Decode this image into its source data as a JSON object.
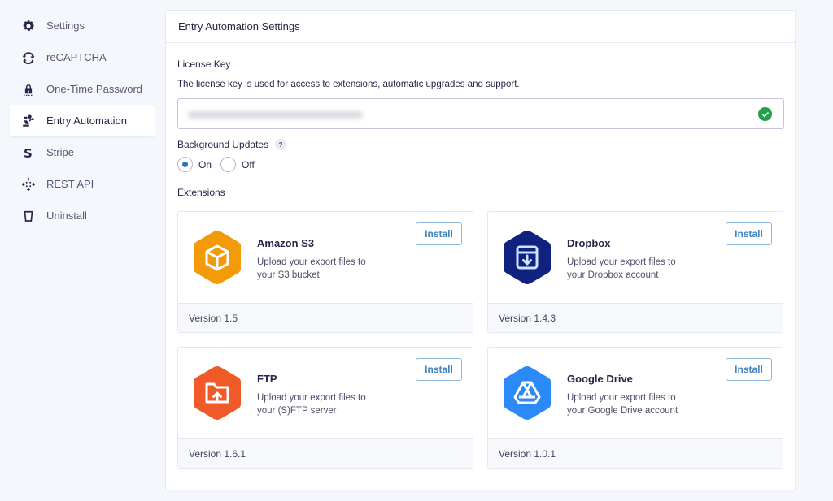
{
  "sidebar": {
    "items": [
      {
        "label": "Settings",
        "icon": "gear-icon",
        "active": false
      },
      {
        "label": "reCAPTCHA",
        "icon": "recaptcha-icon",
        "active": false
      },
      {
        "label": "One-Time Password",
        "icon": "lock-icon",
        "active": false
      },
      {
        "label": "Entry Automation",
        "icon": "robot-arm-icon",
        "active": true
      },
      {
        "label": "Stripe",
        "icon": "stripe-icon",
        "active": false
      },
      {
        "label": "REST API",
        "icon": "api-icon",
        "active": false
      },
      {
        "label": "Uninstall",
        "icon": "trash-icon",
        "active": false
      }
    ]
  },
  "panel": {
    "title": "Entry Automation Settings",
    "license": {
      "label": "License Key",
      "description": "The license key is used for access to extensions, automatic upgrades and support.",
      "value_state": "obscured",
      "status": "valid",
      "status_color": "#21a24a"
    },
    "background_updates": {
      "label": "Background Updates",
      "help": "?",
      "options": [
        "On",
        "Off"
      ],
      "selected": "On"
    },
    "extensions": {
      "label": "Extensions",
      "items": [
        {
          "name": "Amazon S3",
          "description": "Upload your export files to your S3 bucket",
          "version": "Version 1.5",
          "button": "Install",
          "icon": "box-icon",
          "color": "#f29a07"
        },
        {
          "name": "Dropbox",
          "description": "Upload your export files to your Dropbox account",
          "version": "Version 1.4.3",
          "button": "Install",
          "icon": "download-box-icon",
          "color": "#0f2280"
        },
        {
          "name": "FTP",
          "description": "Upload your export files to your (S)FTP server",
          "version": "Version 1.6.1",
          "button": "Install",
          "icon": "folder-upload-icon",
          "color": "#f05a28"
        },
        {
          "name": "Google Drive",
          "description": "Upload your export files to your Google Drive account",
          "version": "Version 1.0.1",
          "button": "Install",
          "icon": "google-drive-icon",
          "color": "#2b8af7"
        }
      ]
    }
  }
}
